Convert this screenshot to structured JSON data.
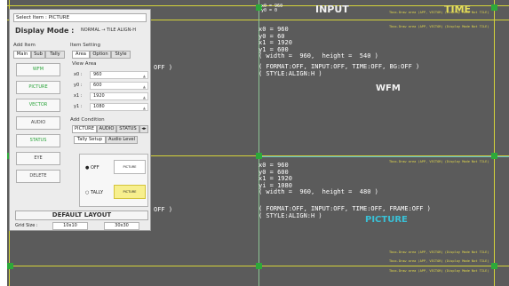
{
  "stage": {
    "top_right_box": "x0 = 960\ny0 = 0",
    "input_title": "INPUT",
    "time_title": "TIME",
    "warn": "Tbox.Draw area (APP, VECTOR) (Display Mode Not TILE)",
    "quad1_coords": "x0 = 960\ny0 = 60\nx1 = 1920\ny1 = 600\n( width =  960,  height =  540 )",
    "quad1_status": "( FORMAT:OFF, INPUT:OFF, TIME:OFF, BG:OFF )\n( STYLE:ALIGN:H )",
    "quad1_name": "WFM",
    "quad2_coords": "x0 = 960\ny0 = 600\nx1 = 1920\nyi = 1080\n( width =  960,  height =  480 )",
    "quad2_status": "( FORMAT:OFF, INPUT:OFF, TIME:OFF, FRAME:OFF )\n( STYLE:ALIGN:H )",
    "quad2_name": "PICTURE",
    "left_frag1": "OFF )",
    "left_frag2": "OFF )"
  },
  "panel": {
    "select_item": "Select Item : PICTURE",
    "display_mode_label": "Display Mode :",
    "display_mode_value": "NORMAL → TILE  ALIGN-H",
    "add_item": "Add Item",
    "item_setting": "Item Setting",
    "left_tabs": [
      "Main",
      "Sub",
      "Tally"
    ],
    "right_tabs": [
      "Area",
      "Option",
      "Style"
    ],
    "buttons": [
      "WFM",
      "PICTURE",
      "VECTOR",
      "AUDIO",
      "STATUS",
      "EYE",
      "DELETE"
    ],
    "view_area": "View Area",
    "fields": [
      {
        "label": "x0 :",
        "value": "960"
      },
      {
        "label": "y0 :",
        "value": "600"
      },
      {
        "label": "x1 :",
        "value": "1920"
      },
      {
        "label": "y1 :",
        "value": "1080"
      }
    ],
    "add_condition": "Add Condition",
    "cond_tabs": [
      "PICTURE",
      "AUDIO",
      "STATUS"
    ],
    "sub_tabs": [
      "Tally Setup",
      "Audio Level"
    ],
    "off_label": "OFF",
    "tally_label": "TALLY",
    "picture_mini": "PICTURE",
    "picture_mini_hl": "PICTURE",
    "default_layout": "DEFAULT LAYOUT",
    "grid_size_label": "Grid Size :",
    "grid_opt1": "10x10",
    "grid_opt2": "30x30"
  }
}
